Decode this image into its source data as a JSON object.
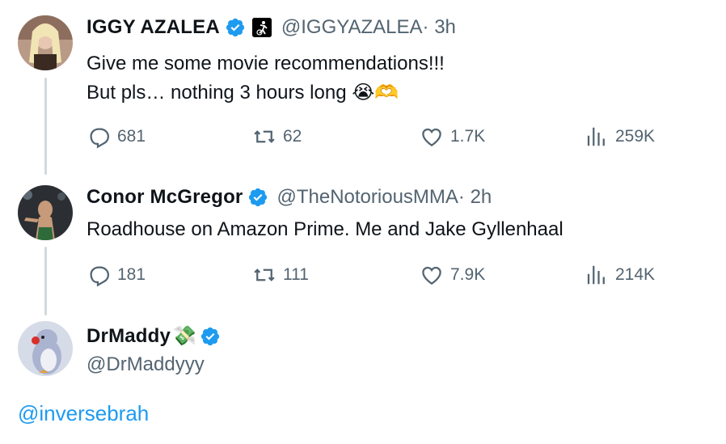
{
  "tweets": [
    {
      "name": "IGGY AZALEA",
      "handle": "@IGGYAZALEA",
      "time": " · 3h",
      "lines": [
        "Give me some movie recommendations!!!",
        "But pls… nothing 3 hours long"
      ],
      "emojis": "😭🫶",
      "replies": "681",
      "retweets": "62",
      "likes": "1.7K",
      "views": "259K"
    },
    {
      "name": "Conor McGregor",
      "handle": "@TheNotoriousMMA",
      "time": " · 2h",
      "lines": [
        "Roadhouse on Amazon Prime. Me and Jake Gyllenhaal"
      ],
      "replies": "181",
      "retweets": "111",
      "likes": "7.9K",
      "views": "214K"
    },
    {
      "name": "DrMaddy",
      "name_emoji": "💸",
      "handle": "@DrMaddyyy",
      "mention": "@inversebrah"
    }
  ],
  "icons": {
    "verified": "verified-badge-icon",
    "reply": "reply-icon",
    "retweet": "retweet-icon",
    "like": "heart-icon",
    "views": "views-icon"
  },
  "colors": {
    "verified": "#1d9bf0",
    "link": "#1d9bf0",
    "secondary": "#536471",
    "thread_line": "#cfd9de"
  }
}
